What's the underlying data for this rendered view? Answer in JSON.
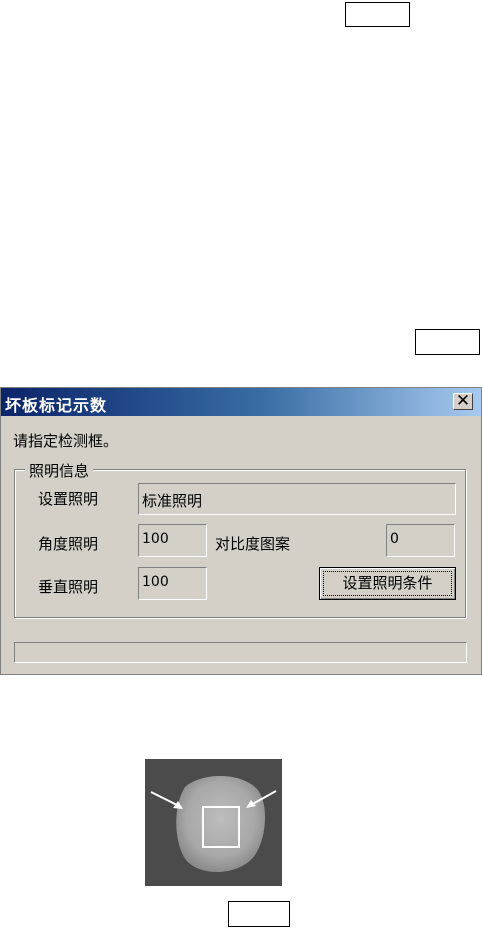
{
  "dialog": {
    "title": "坏板标记示数",
    "close_glyph": "✕",
    "prompt": "请指定检测框。",
    "group_title": "照明信息",
    "fields": {
      "setting_label": "设置照明",
      "setting_value": "标准照明",
      "angle_label": "角度照明",
      "angle_value": "100",
      "contrast_label": "对比度图案",
      "contrast_value": "0",
      "vertical_label": "垂直照明",
      "vertical_value": "100"
    },
    "set_button_label": "设置照明条件"
  },
  "colors": {
    "titlebar_start": "#0a246a",
    "titlebar_end": "#a6caf0",
    "dialog_bg": "#d4d0c8"
  }
}
